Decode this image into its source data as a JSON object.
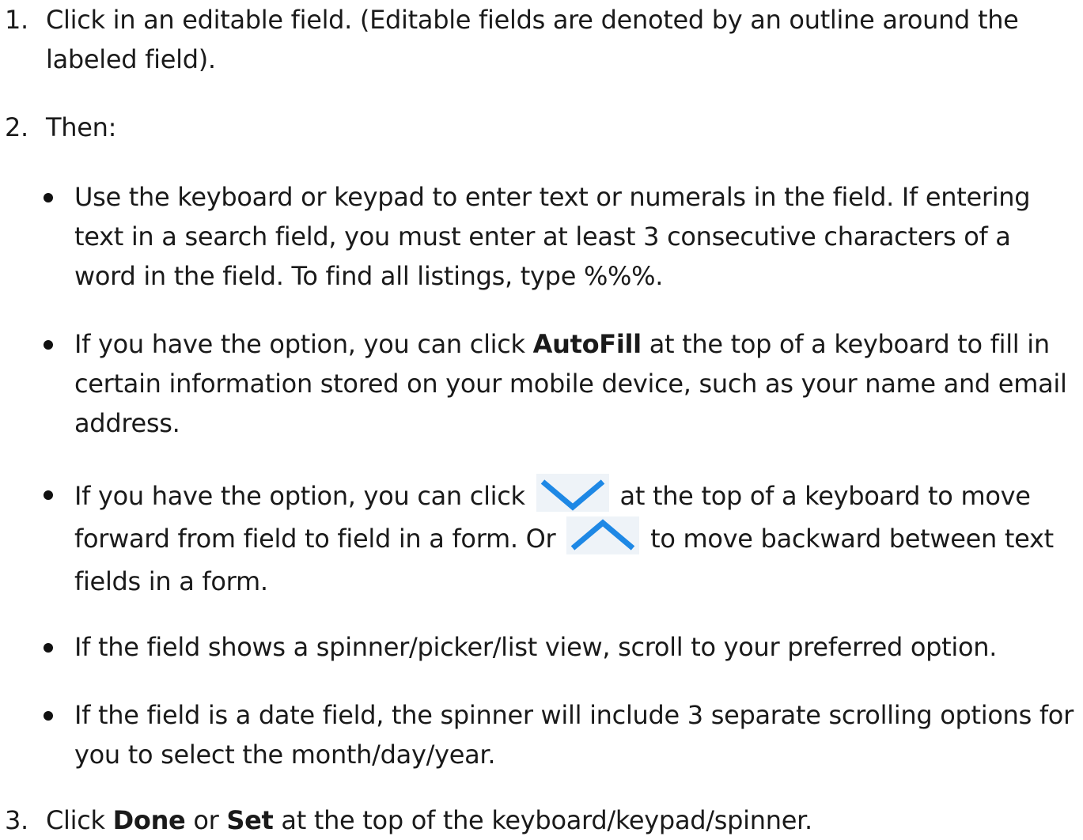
{
  "steps": [
    {
      "number": "1.",
      "text": "Click in an editable field. (Editable fields are denoted by an outline around the labeled field)."
    },
    {
      "number": "2.",
      "text": "Then:"
    },
    {
      "number": "3.",
      "pre": "Click ",
      "bold1": "Done",
      "mid": " or ",
      "bold2": "Set",
      "post": " at the top of the keyboard/keypad/spinner."
    }
  ],
  "bullets": [
    {
      "text": "Use the keyboard or keypad to enter text or numerals in the field. If entering text in a search field, you must enter at least 3 consecutive characters of a word in the field. To find all listings, type %%%."
    },
    {
      "pre": "If you have the option, you can click ",
      "bold": "AutoFill",
      "post": " at the top of a keyboard to fill in certain information stored on your mobile device, such as your name and email address."
    },
    {
      "pre": "If you have the option, you can click ",
      "icon1": "chevron-down-icon",
      "mid": " at the top of a keyboard to move forward from field to field in a form. Or ",
      "icon2": "chevron-up-icon",
      "post": " to move backward between text fields in a form."
    },
    {
      "text": "If the field shows a spinner/picker/list view, scroll to your preferred option."
    },
    {
      "text": "If the field is a date field, the spinner will include 3 separate scrolling options for you to select the month/day/year."
    }
  ],
  "colors": {
    "text": "#1a1a1a",
    "icon_blue": "#1e88e5"
  }
}
